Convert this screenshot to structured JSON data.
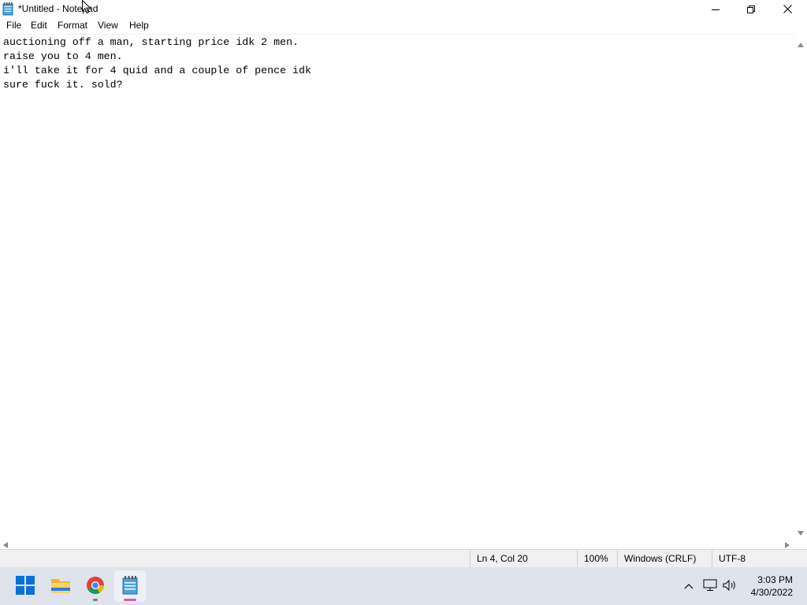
{
  "window": {
    "title": "*Untitled - Notepad",
    "icon": "notepad-icon",
    "controls": [
      "minimize-icon",
      "restore-icon",
      "close-icon"
    ]
  },
  "menubar": {
    "items": [
      {
        "label": "File"
      },
      {
        "label": "Edit"
      },
      {
        "label": "Format"
      },
      {
        "label": "View"
      },
      {
        "label": "Help"
      }
    ]
  },
  "editor": {
    "content": "auctioning off a man, starting price idk 2 men.\nraise you to 4 men.\ni'll take it for 4 quid and a couple of pence idk\nsure fuck it. sold?"
  },
  "statusbar": {
    "position": "Ln 4, Col 20",
    "zoom": "100%",
    "line_ending": "Windows (CRLF)",
    "encoding": "UTF-8"
  },
  "taskbar": {
    "apps": [
      {
        "name": "start-icon"
      },
      {
        "name": "file-explorer-icon"
      },
      {
        "name": "chrome-icon"
      },
      {
        "name": "notepad-icon"
      }
    ],
    "tray": [
      "chevron-up-icon",
      "network-icon",
      "volume-icon"
    ],
    "clock": {
      "time": "3:03 PM",
      "date": "4/30/2022"
    }
  },
  "colors": {
    "taskbar_bg": "#dfe3ec",
    "status_bg": "#f0f0f0",
    "start_blue": "#0a6fd8"
  }
}
